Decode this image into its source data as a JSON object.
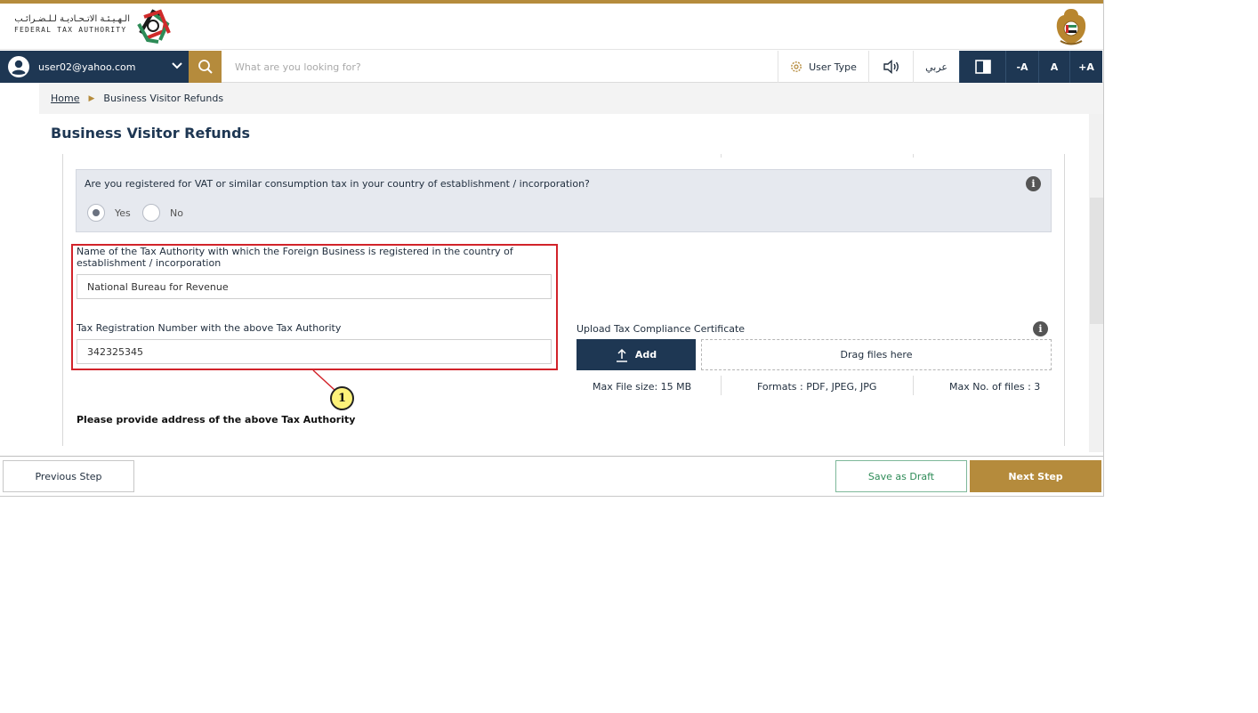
{
  "brand": {
    "name_ar": "الـهـيـئـة الاتـحـاديـة لـلـضـرائـب",
    "name_en": "FEDERAL TAX AUTHORITY",
    "logo_icon": "fta-swirl-logo-icon",
    "emblem_icon": "uae-emblem-icon"
  },
  "toolbar": {
    "user_email": "user02@yahoo.com",
    "search_placeholder": "What are you looking for?",
    "user_type_label": "User Type",
    "language_label": "عربي",
    "font_decrease": "-A",
    "font_normal": "A",
    "font_increase": "+A",
    "icons": [
      "user-avatar-icon",
      "chevron-down-icon",
      "search-icon",
      "gear-icon",
      "speaker-icon",
      "contrast-icon"
    ]
  },
  "breadcrumb": {
    "home": "Home",
    "current": "Business Visitor Refunds"
  },
  "page": {
    "title": "Business Visitor Refunds"
  },
  "question": {
    "text": "Are you registered for VAT or similar consumption tax in your country of establishment / incorporation?",
    "options": [
      "Yes",
      "No"
    ],
    "selected": "Yes"
  },
  "form": {
    "authority_label": "Name of the Tax Authority with which the Foreign Business is registered in the country of establishment / incorporation",
    "authority_value": "National Bureau for Revenue",
    "trn_label": "Tax Registration Number with the above Tax Authority",
    "trn_value": "342325345",
    "address_heading": "Please provide address of the above Tax Authority"
  },
  "upload": {
    "label": "Upload Tax Compliance Certificate",
    "add_button": "Add",
    "drop_text": "Drag files here",
    "max_size": "Max File size: 15 MB",
    "formats": "Formats : PDF, JPEG, JPG",
    "max_files": "Max No. of files : 3"
  },
  "annotation": {
    "callout_number": "1",
    "highlight_color": "#d2232a",
    "callout_color": "#fdf27a"
  },
  "footer": {
    "previous": "Previous Step",
    "save_draft": "Save as Draft",
    "next": "Next Step"
  },
  "colors": {
    "navy": "#1e3753",
    "gold": "#b58b3c",
    "draft_green": "#2e8b57"
  }
}
